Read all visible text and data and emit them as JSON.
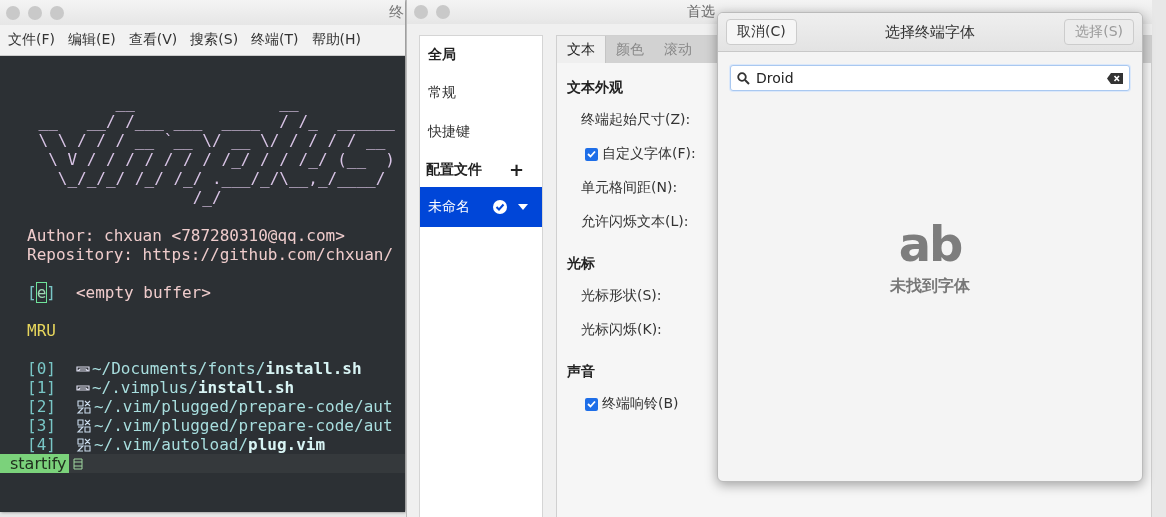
{
  "terminal": {
    "title": "终",
    "menu": [
      "文件(F)",
      "编辑(E)",
      "查看(V)",
      "搜索(S)",
      "终端(T)",
      "帮助(H)"
    ],
    "banner": [
      "            __               __",
      "    __   __/ /___ ___  ____  / /_  ______",
      "    \\ \\ / / / __ `__ \\/ __ \\/ / / / / __",
      "     \\ V / / / / / / / /_/ / / /_/ (__  )",
      "      \\_/_/_/ /_/ /_/ .___/_/\\__,_/____/",
      "                    /_/"
    ],
    "author": "Author: chxuan <787280310@qq.com>",
    "repository": "Repository: https://github.com/chxuan/",
    "buffer": {
      "open": "[",
      "key": "e",
      "close": "]",
      "label": "<empty buffer>"
    },
    "mru_heading": "MRU",
    "mru": [
      {
        "index": "[0]",
        "kind": "shell",
        "dir": "~/Documents/fonts/",
        "file": "install.sh"
      },
      {
        "index": "[1]",
        "kind": "shell",
        "dir": "~/.vimplus/",
        "file": "install.sh"
      },
      {
        "index": "[2]",
        "kind": "vim",
        "dir": "~/.vim/plugged/prepare-code/aut"
      },
      {
        "index": "[3]",
        "kind": "vim",
        "dir": "~/.vim/plugged/prepare-code/aut"
      },
      {
        "index": "[4]",
        "kind": "vim",
        "dir": "~/.vim/autoload/",
        "file": "plug.vim"
      }
    ],
    "status": {
      "mode": "startify"
    }
  },
  "preferences": {
    "title": "首选",
    "sidebar": {
      "global_heading": "全局",
      "items": [
        {
          "label": "常规",
          "selected": false
        },
        {
          "label": "快捷键",
          "selected": false
        }
      ],
      "profiles_heading": "配置文件",
      "add": "+",
      "profiles": [
        {
          "name": "未命名",
          "selected": true,
          "default": true
        }
      ]
    },
    "tabs": [
      {
        "label": "文本",
        "selected": true
      },
      {
        "label": "颜色",
        "selected": false
      },
      {
        "label": "滚动",
        "selected": false
      }
    ],
    "sections": [
      {
        "heading": "文本外观",
        "rows": [
          {
            "kind": "label",
            "label": "终端起始尺寸(Z):"
          },
          {
            "kind": "checkbox",
            "label": "自定义字体(F):",
            "checked": true
          },
          {
            "kind": "label",
            "label": "单元格间距(N):"
          },
          {
            "kind": "label",
            "label": "允许闪烁文本(L):"
          }
        ]
      },
      {
        "heading": "光标",
        "rows": [
          {
            "kind": "label",
            "label": "光标形状(S):"
          },
          {
            "kind": "label",
            "label": "光标闪烁(K):"
          }
        ]
      },
      {
        "heading": "声音",
        "rows": [
          {
            "kind": "checkbox",
            "label": "终端响铃(B)",
            "checked": true
          }
        ]
      }
    ]
  },
  "font_dialog": {
    "cancel": "取消(C)",
    "title": "选择终端字体",
    "select": {
      "label": "选择(S)",
      "disabled": true
    },
    "search": {
      "value": "Droid"
    },
    "empty": {
      "icon_text": "ab",
      "message": "未找到字体"
    }
  }
}
